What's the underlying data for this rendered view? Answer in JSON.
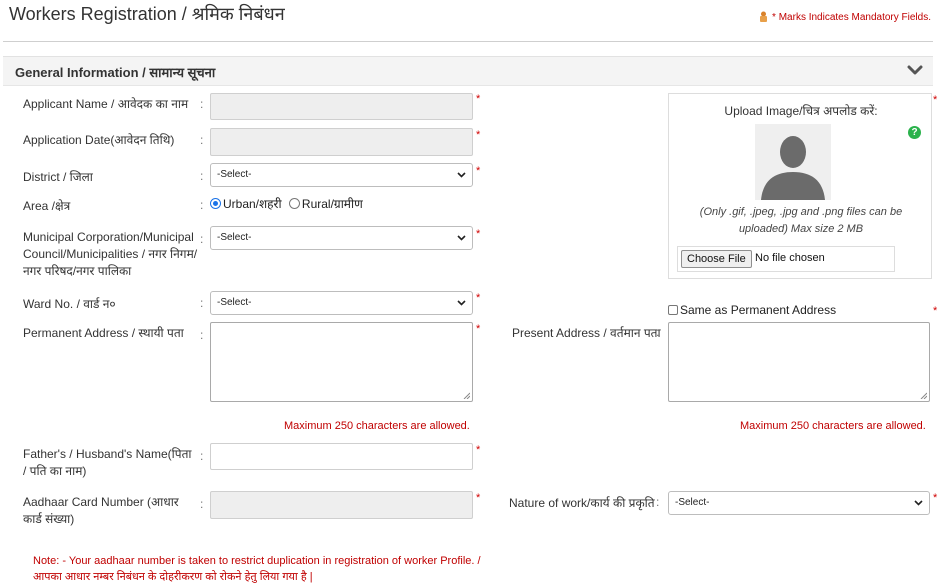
{
  "header": {
    "title": "Workers Registration / श्रमिक निबंधन",
    "mandatory_note": "* Marks Indicates Mandatory Fields."
  },
  "section": {
    "title": "General Information / सामान्य सूचना"
  },
  "fields": {
    "applicant_name": {
      "label": "Applicant Name / आवेदक का नाम",
      "value": ""
    },
    "application_date": {
      "label": "Application Date(आवेदन तिथि)",
      "value": ""
    },
    "district": {
      "label": "District / जिला",
      "selected": "-Select-"
    },
    "area": {
      "label": "Area /क्षेत्र",
      "options": [
        "Urban/शहरी",
        "Rural/ग्रामीण"
      ],
      "selected": "Urban/शहरी"
    },
    "municipal": {
      "label": "Municipal Corporation/Municipal Council/Municipalities / नगर निगम/ नगर परिषद/नगर पालिका",
      "selected": "-Select-"
    },
    "ward": {
      "label": "Ward No. / वार्ड न०",
      "selected": "-Select-"
    },
    "permanent_address": {
      "label": "Permanent Address / स्थायी पता",
      "value": "",
      "max_note": "Maximum 250 characters are allowed."
    },
    "present_address": {
      "label": "Present Address / वर्तमान पता",
      "value": "",
      "max_note": "Maximum 250 characters are allowed."
    },
    "same_as_permanent": {
      "label": "Same as Permanent Address",
      "checked": false
    },
    "father_name": {
      "label": "Father's / Husband's Name(पिता / पति का नाम)",
      "value": ""
    },
    "aadhaar": {
      "label": "Aadhaar Card Number (आधार कार्ड संख्या)",
      "value": ""
    },
    "nature_of_work": {
      "label": "Nature of work/कार्य की प्रकृति",
      "selected": "-Select-"
    }
  },
  "upload": {
    "title": "Upload Image/चित्र अपलोड करें:",
    "hint": "(Only .gif, .jpeg, .jpg and .png files can be uploaded) Max size 2 MB",
    "button": "Choose File",
    "status": "No file chosen"
  },
  "common": {
    "colon": ":",
    "required_mark": "*"
  },
  "note": {
    "line1": "Note: - Your aadhaar number is taken to restrict duplication in registration of worker Profile. /",
    "line2": "आपका आधार नम्बर निबंधन के दोहरीकरण को रोकने हेतु लिया गया है |"
  },
  "colors": {
    "required": "#d00000",
    "accent_radio": "#1a73e8",
    "help": "#2bb24c"
  }
}
